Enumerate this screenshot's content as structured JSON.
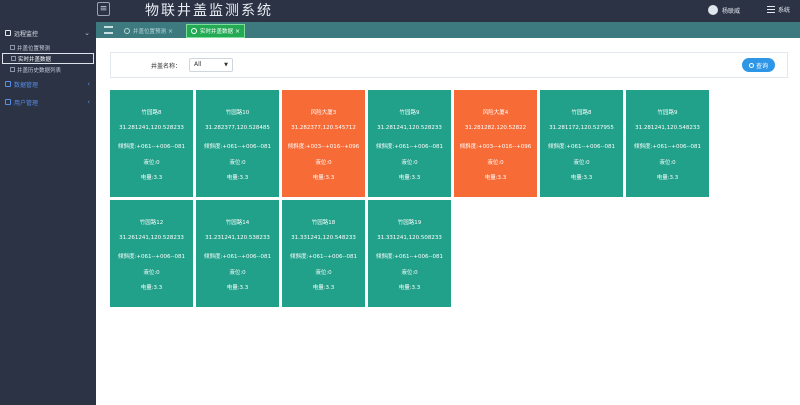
{
  "header": {
    "title": "物联井盖监测系统",
    "user_name": "杨联威",
    "system_label": "系统"
  },
  "sidebar": {
    "groups": [
      {
        "label": "远程监控",
        "expanded": true,
        "items": [
          {
            "label": "井盖位置预测"
          },
          {
            "label": "实时井盖数据",
            "selected": true
          },
          {
            "label": "井盖历史数据列表"
          }
        ]
      },
      {
        "label": "数据管理"
      },
      {
        "label": "用户管理"
      }
    ]
  },
  "tabs": [
    {
      "label": "井盖位置预测"
    },
    {
      "label": "实时井盖数据",
      "active": true
    }
  ],
  "filter": {
    "label": "井盖名称：",
    "select_value": "All",
    "query_label": "查询"
  },
  "colors": {
    "ok": "#21a08a",
    "alarm": "#f76b36",
    "accent": "#2e96e6"
  },
  "cards": [
    {
      "name": "竹园路8",
      "coord": "31.281241,120.528233",
      "tilt": "倾斜度:+061--+006--081",
      "level": "液位:0",
      "power": "电量:3.3",
      "status": "ok"
    },
    {
      "name": "竹园路10",
      "coord": "31.282377,120.528485",
      "tilt": "倾斜度:+061--+006--081",
      "level": "液位:0",
      "power": "电量:3.3",
      "status": "ok"
    },
    {
      "name": "风险大厦3",
      "coord": "31.282377,120.545712",
      "tilt": "倾斜度:+003--+016--+096",
      "level": "液位:0",
      "power": "电量:3.3",
      "status": "alarm"
    },
    {
      "name": "竹园路9",
      "coord": "31.281241,120.528233",
      "tilt": "倾斜度:+061--+006--081",
      "level": "液位:0",
      "power": "电量:3.3",
      "status": "ok"
    },
    {
      "name": "风险大厦4",
      "coord": "31.281282,120.52822",
      "tilt": "倾斜度:+003--+016--+096",
      "level": "液位:0",
      "power": "电量:3.3",
      "status": "alarm"
    },
    {
      "name": "竹园路8",
      "coord": "31.281172,120.527955",
      "tilt": "倾斜度:+061--+006--081",
      "level": "液位:0",
      "power": "电量:3.3",
      "status": "ok"
    },
    {
      "name": "竹园路9",
      "coord": "31.281241,120.548233",
      "tilt": "倾斜度:+061--+006--081",
      "level": "液位:0",
      "power": "电量:3.3",
      "status": "ok"
    },
    {
      "name": "竹园路12",
      "coord": "31.261241,120.528233",
      "tilt": "倾斜度:+061--+006--081",
      "level": "液位:0",
      "power": "电量:3.3",
      "status": "ok"
    },
    {
      "name": "竹园路14",
      "coord": "31.231241,120.538233",
      "tilt": "倾斜度:+061--+006--081",
      "level": "液位:0",
      "power": "电量:3.3",
      "status": "ok"
    },
    {
      "name": "竹园路18",
      "coord": "31.331241,120.548233",
      "tilt": "倾斜度:+061--+006--081",
      "level": "液位:0",
      "power": "电量:3.3",
      "status": "ok"
    },
    {
      "name": "竹园路19",
      "coord": "31.331241,120.508233",
      "tilt": "倾斜度:+061--+006--081",
      "level": "液位:0",
      "power": "电量:3.3",
      "status": "ok"
    }
  ]
}
